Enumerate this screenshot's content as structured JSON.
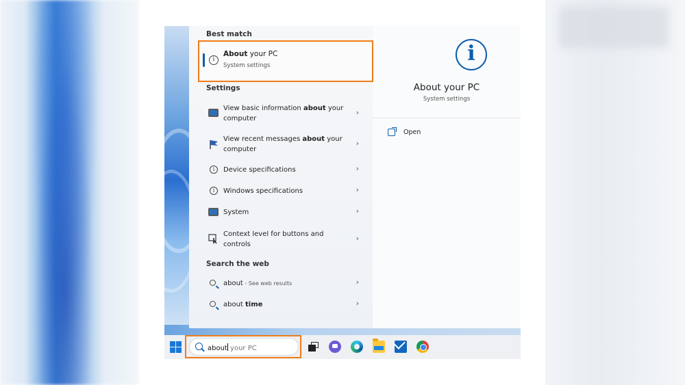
{
  "best_match": {
    "section_title": "Best match",
    "item": {
      "title_bold": "About",
      "title_rest": " your PC",
      "subtitle": "System settings",
      "icon": "info-icon"
    }
  },
  "settings": {
    "section_title": "Settings",
    "items": [
      {
        "pre": "View basic information ",
        "bold": "about",
        "post": " your computer",
        "icon": "monitor-icon"
      },
      {
        "pre": "View recent messages ",
        "bold": "about",
        "post": " your computer",
        "icon": "flag-icon"
      },
      {
        "pre": "Device specifications",
        "bold": "",
        "post": "",
        "icon": "info-icon"
      },
      {
        "pre": "Windows specifications",
        "bold": "",
        "post": "",
        "icon": "info-icon"
      },
      {
        "pre": "System",
        "bold": "",
        "post": "",
        "icon": "monitor-icon"
      },
      {
        "pre": "Context level for buttons and controls",
        "bold": "",
        "post": "",
        "icon": "touch-icon"
      }
    ]
  },
  "web": {
    "section_title": "Search the web",
    "items": [
      {
        "term": "about",
        "suffix": " - See web results",
        "bold": false
      },
      {
        "term": "about ",
        "bold_part": "time",
        "bold": true
      }
    ]
  },
  "detail": {
    "title": "About your PC",
    "subtitle": "System settings",
    "open_label": "Open"
  },
  "taskbar": {
    "search_typed": "about",
    "search_hint": " your PC",
    "apps": [
      "task-view",
      "chat",
      "edge",
      "file-explorer",
      "mail",
      "chrome"
    ]
  },
  "colors": {
    "highlight": "#ef7d1a",
    "accent": "#0b5cad"
  }
}
